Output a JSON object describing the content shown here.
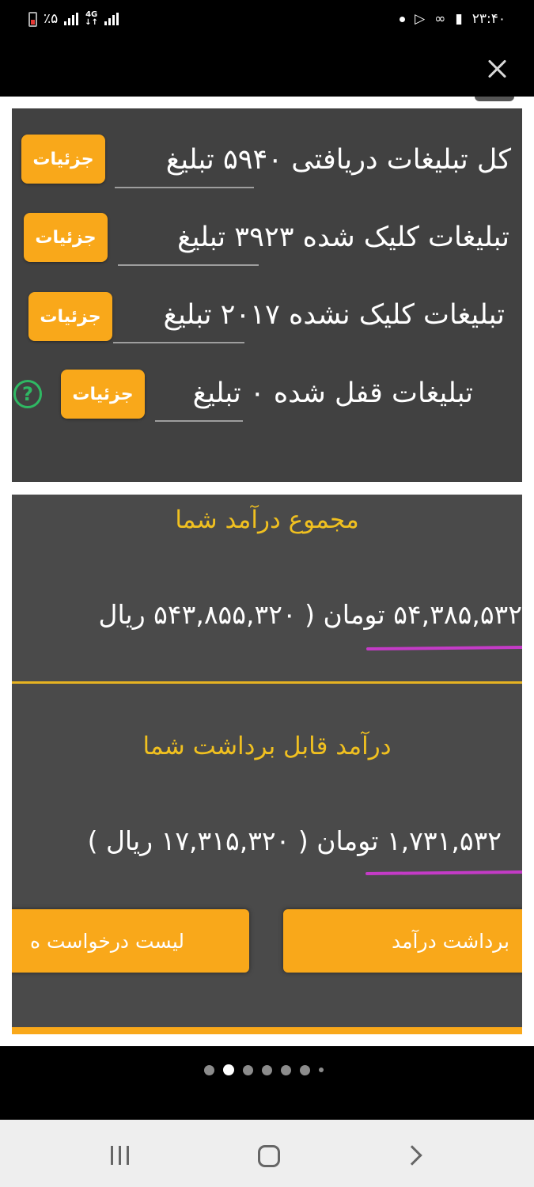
{
  "status_bar": {
    "battery_percent": "٪۵",
    "network_type": "4G",
    "time": "۲۳:۴۰",
    "icons": [
      "battery-icon",
      "signal-icon",
      "lte-icon",
      "dot-icon",
      "play-store-icon",
      "infinity-icon",
      "notification-icon"
    ]
  },
  "ads": {
    "rows": [
      {
        "text": "کل تبلیغات دریافتی ۵۹۴۰ تبلیغ",
        "button": "جزئیات"
      },
      {
        "text": "تبلیغات کلیک شده ۳۹۲۳ تبلیغ",
        "button": "جزئیات"
      },
      {
        "text": "تبلیغات کلیک نشده ۲۰۱۷ تبلیغ",
        "button": "جزئیات"
      },
      {
        "text": "تبلیغات قفل شده ۰ تبلیغ",
        "button": "جزئیات"
      }
    ],
    "help_glyph": "?"
  },
  "income": {
    "total_title": "مجموع درآمد شما",
    "total_amount": "۵۴,۳۸۵,۵۳۲ تومان ( ۵۴۳,۸۵۵,۳۲۰ ریال",
    "withdrawable_title": "درآمد قابل برداشت شما",
    "withdrawable_amount": "۱,۷۳۱,۵۳۲ تومان ( ۱۷,۳۱۵,۳۲۰ ریال )",
    "withdraw_button": "برداشت درآمد",
    "requests_button": "لیست درخواست ه"
  },
  "pager": {
    "count": 7,
    "active_index": 1
  },
  "colors": {
    "accent": "#f9a81a",
    "title_gold": "#f0c020",
    "panel_dark": "#414141",
    "underline_pink": "#c43bc7",
    "help_green": "#2fb863"
  }
}
